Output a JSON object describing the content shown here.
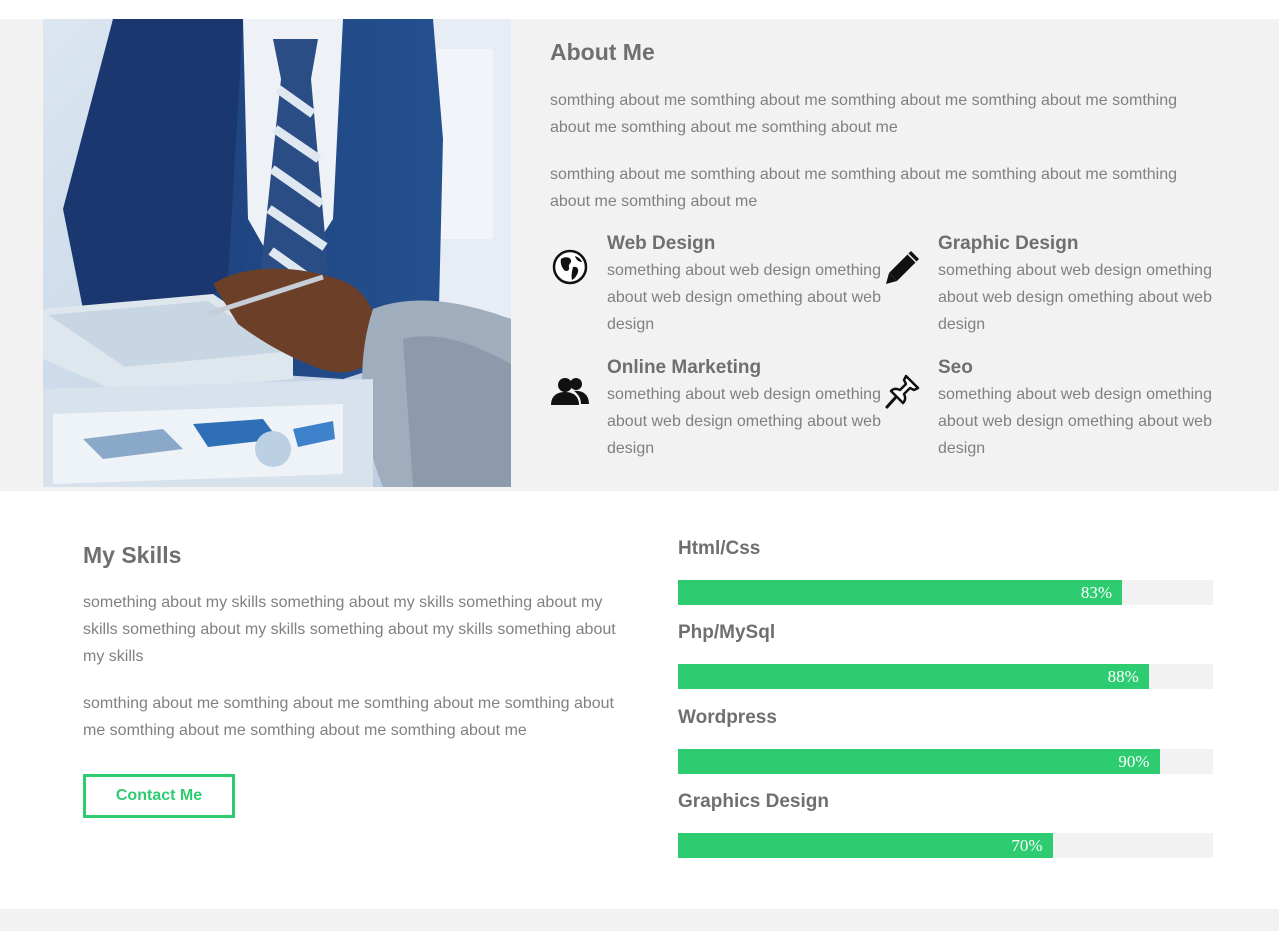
{
  "about": {
    "title": "About Me",
    "paragraphs": [
      "somthing about me somthing about me somthing about me somthing about me somthing about me somthing about me somthing about me",
      "somthing about me somthing about me somthing about me somthing about me somthing about me somthing about me"
    ],
    "services": [
      {
        "icon": "globe-icon",
        "title": "Web Design",
        "description": "something about web design omething about web design omething about web design"
      },
      {
        "icon": "pencil-icon",
        "title": "Graphic Design",
        "description": "something about web design omething about web design omething about web design"
      },
      {
        "icon": "users-icon",
        "title": "Online Marketing",
        "description": "something about web design omething about web design omething about web design"
      },
      {
        "icon": "pushpin-icon",
        "title": "Seo",
        "description": "something about web design omething about web design omething about web design"
      }
    ]
  },
  "skills": {
    "title": "My Skills",
    "paragraphs": [
      "something about my skills something about my skills something about my skills something about my skills something about my skills something about my skills",
      "somthing about me somthing about me somthing about me somthing about me somthing about me somthing about me somthing about me"
    ],
    "contact_label": "Contact Me",
    "items": [
      {
        "name": "Html/Css",
        "percent_label": "83%",
        "value": 83
      },
      {
        "name": "Php/MySql",
        "percent_label": "88%",
        "value": 88
      },
      {
        "name": "Wordpress",
        "percent_label": "90%",
        "value": 90
      },
      {
        "name": "Graphics Design",
        "percent_label": "70%",
        "value": 70
      }
    ]
  },
  "colors": {
    "accent": "#2ecc71",
    "section_bg": "#f2f2f2",
    "heading": "#6f6f6f",
    "body_text": "#808080"
  }
}
